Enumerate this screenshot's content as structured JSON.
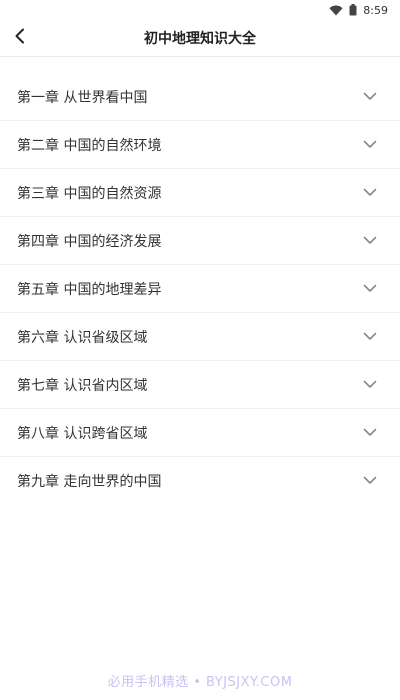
{
  "status_bar": {
    "time": "8:59",
    "wifi_icon": "wifi-icon",
    "battery_icon": "battery-icon"
  },
  "header": {
    "title": "初中地理知识大全",
    "back_icon": "chevron-left-icon"
  },
  "chapters": [
    {
      "label": "第一章 从世界看中国",
      "icon": "chevron-down-icon"
    },
    {
      "label": "第二章 中国的自然环境",
      "icon": "chevron-down-icon"
    },
    {
      "label": "第三章 中国的自然资源",
      "icon": "chevron-down-icon"
    },
    {
      "label": "第四章 中国的经济发展",
      "icon": "chevron-down-icon"
    },
    {
      "label": "第五章 中国的地理差异",
      "icon": "chevron-down-icon"
    },
    {
      "label": "第六章 认识省级区域",
      "icon": "chevron-down-icon"
    },
    {
      "label": "第七章 认识省内区域",
      "icon": "chevron-down-icon"
    },
    {
      "label": "第八章 认识跨省区域",
      "icon": "chevron-down-icon"
    },
    {
      "label": "第九章 走向世界的中国",
      "icon": "chevron-down-icon"
    }
  ],
  "watermark": "必用手机精选 • BYJSJXY.COM",
  "colors": {
    "background": "#ffffff",
    "text": "#333333",
    "chevron": "#888888",
    "divider": "#f0f0f0",
    "watermark": "#c9c2f3"
  }
}
